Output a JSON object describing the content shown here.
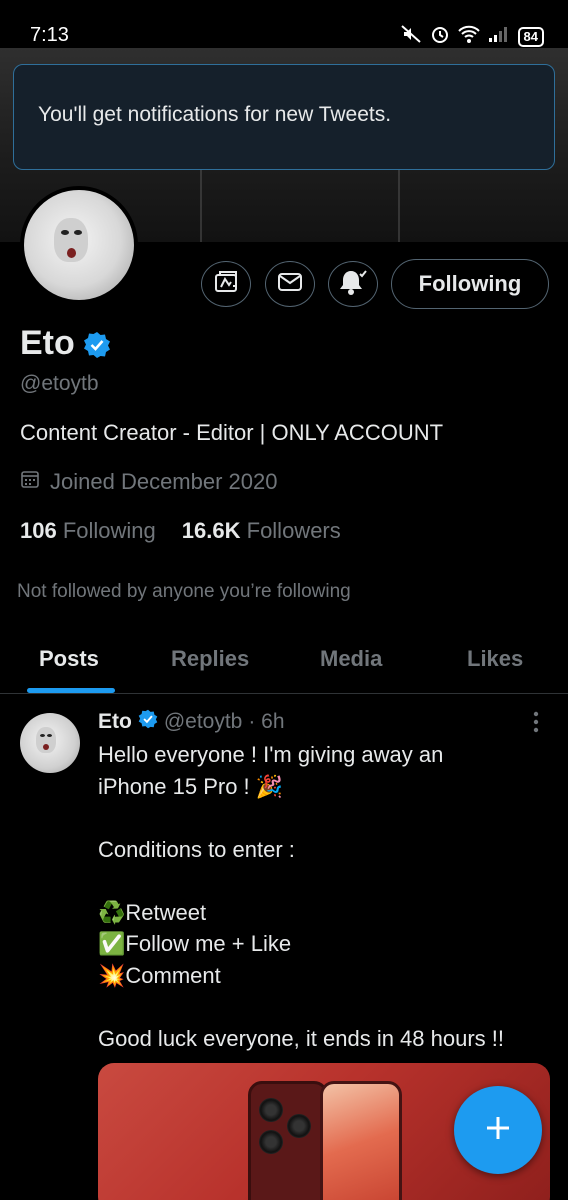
{
  "status_bar": {
    "time": "7:13",
    "battery": "84"
  },
  "toast": {
    "message": "You'll get notifications for new Tweets."
  },
  "profile": {
    "name": "Eto",
    "handle": "@etoytb",
    "bio": "Content Creator - Editor | ONLY ACCOUNT",
    "joined": "Joined December 2020",
    "following_count": "106",
    "following_label": "Following",
    "followers_count": "16.6K",
    "followers_label": "Followers",
    "not_followed_note": "Not followed by anyone you’re following",
    "following_button": "Following",
    "verified_color": "#1d9bf0"
  },
  "tabs": [
    "Posts",
    "Replies",
    "Media",
    "Likes"
  ],
  "post": {
    "name": "Eto",
    "handle": "@etoytb",
    "time": "· 6h",
    "lines": [
      "Hello everyone ! I'm giving away an",
      "iPhone 15 Pro ! 🎉",
      "",
      "Conditions to enter :",
      "",
      "♻️Retweet",
      "✅Follow me + Like",
      "💥Comment",
      "",
      "Good luck everyone, it ends in 48 hours !!"
    ]
  },
  "icons": {
    "action_buttons": [
      "grok-icon",
      "message-icon",
      "notification-bell-icon"
    ],
    "fab": "compose-plus-icon"
  },
  "colors": {
    "accent": "#1d9bf0",
    "background": "#000000",
    "secondary_text": "#71767b",
    "toast_bg": "#15202b"
  }
}
